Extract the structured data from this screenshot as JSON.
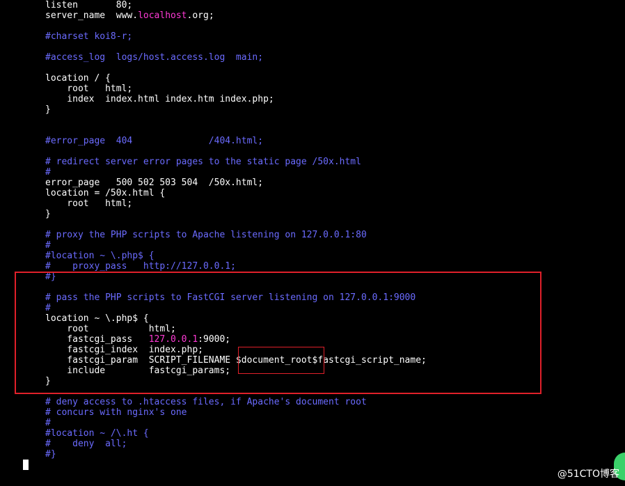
{
  "lines": [
    [
      [
        "listen       80;",
        "w"
      ]
    ],
    [
      [
        "server_name  www.",
        "w"
      ],
      [
        "localhost",
        "m"
      ],
      [
        ".org;",
        "w"
      ]
    ],
    [],
    [
      [
        "#charset koi8-r;",
        "c"
      ]
    ],
    [],
    [
      [
        "#access_log  logs/host.access.log  main;",
        "c"
      ]
    ],
    [],
    [
      [
        "location / {",
        "w"
      ]
    ],
    [
      [
        "    root   html;",
        "w"
      ]
    ],
    [
      [
        "    index  index.html index.htm index.php;",
        "w"
      ]
    ],
    [
      [
        "}",
        "w"
      ]
    ],
    [],
    [],
    [
      [
        "#error_page  404              /404.html;",
        "c"
      ]
    ],
    [],
    [
      [
        "# redirect server error pages to the static page /50x.html",
        "c"
      ]
    ],
    [
      [
        "#",
        "c"
      ]
    ],
    [
      [
        "error_page   500 502 503 504  /50x.html;",
        "w"
      ]
    ],
    [
      [
        "location = /50x.html {",
        "w"
      ]
    ],
    [
      [
        "    root   html;",
        "w"
      ]
    ],
    [
      [
        "}",
        "w"
      ]
    ],
    [],
    [
      [
        "# proxy the PHP scripts to Apache listening on 127.0.0.1:80",
        "c"
      ]
    ],
    [
      [
        "#",
        "c"
      ]
    ],
    [
      [
        "#location ~ \\.php$ {",
        "c"
      ]
    ],
    [
      [
        "#    proxy_pass   http://127.0.0.1;",
        "c"
      ]
    ],
    [
      [
        "#}",
        "c"
      ]
    ],
    [],
    [
      [
        "# pass the PHP scripts to FastCGI server listening on 127.0.0.1:9000",
        "c"
      ]
    ],
    [
      [
        "#",
        "c"
      ]
    ],
    [
      [
        "location ~ \\.php$ {",
        "w"
      ]
    ],
    [
      [
        "    root           html;",
        "w"
      ]
    ],
    [
      [
        "    fastcgi_pass   ",
        "w"
      ],
      [
        "127.0.0.1",
        "m"
      ],
      [
        ":9000;",
        "w"
      ]
    ],
    [
      [
        "    fastcgi_index  index.php;",
        "w"
      ]
    ],
    [
      [
        "    fastcgi_param  SCRIPT_FILENAME $document_root$fastcgi_script_name;",
        "w"
      ]
    ],
    [
      [
        "    include        fastcgi_params;",
        "w"
      ]
    ],
    [
      [
        "}",
        "w"
      ]
    ],
    [],
    [
      [
        "# deny access to .htaccess files, if Apache's document root",
        "c"
      ]
    ],
    [
      [
        "# concurs with nginx's one",
        "c"
      ]
    ],
    [
      [
        "#",
        "c"
      ]
    ],
    [
      [
        "#location ~ /\\.ht {",
        "c"
      ]
    ],
    [
      [
        "#    deny  all;",
        "c"
      ]
    ],
    [
      [
        "#}",
        "c"
      ]
    ]
  ],
  "watermark": "@51CTO博客",
  "colors": {
    "background": "#000000",
    "text": "#ffffff",
    "comment": "#6b6bff",
    "highlight": "#ff3ad6",
    "annotation_box": "#e0202a"
  }
}
